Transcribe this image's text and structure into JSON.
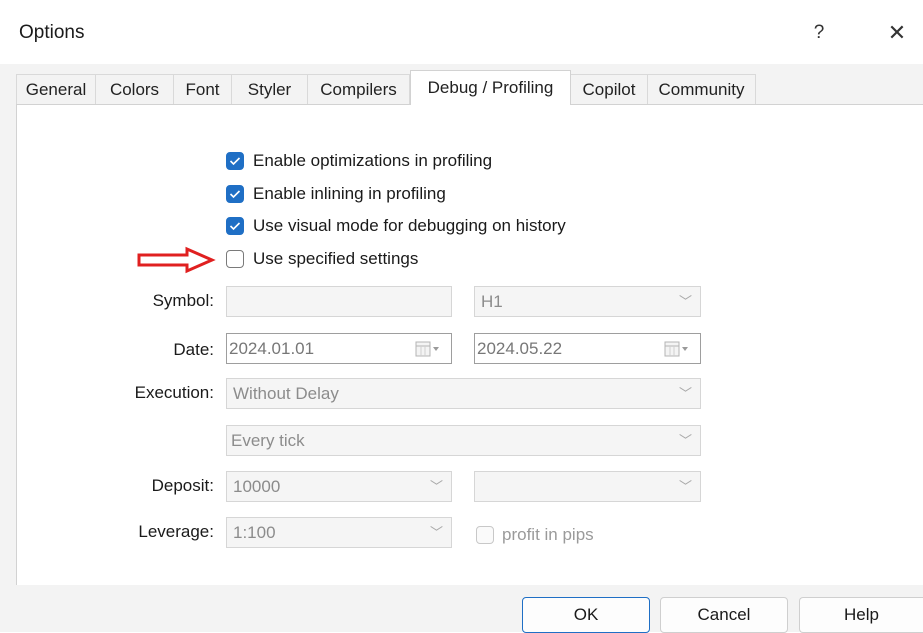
{
  "window": {
    "title": "Options",
    "help_label": "?",
    "close_label": "✕"
  },
  "tabs": [
    {
      "label": "General"
    },
    {
      "label": "Colors"
    },
    {
      "label": "Font"
    },
    {
      "label": "Styler"
    },
    {
      "label": "Compilers"
    },
    {
      "label": "Debug / Profiling",
      "active": true
    },
    {
      "label": "Copilot"
    },
    {
      "label": "Community"
    }
  ],
  "checkboxes": {
    "opt_profiling": {
      "label": "Enable optimizations in profiling",
      "checked": true
    },
    "inline_profiling": {
      "label": "Enable inlining in profiling",
      "checked": true
    },
    "visual_mode": {
      "label": "Use visual mode for debugging on history",
      "checked": true
    },
    "specified_settings": {
      "label": "Use specified settings",
      "checked": false
    },
    "profit_pips": {
      "label": "profit in pips",
      "checked": false
    }
  },
  "form": {
    "symbol_label": "Symbol:",
    "symbol_value": "",
    "timeframe_value": "H1",
    "date_label": "Date:",
    "date_from": "2024.01.01",
    "date_to": "2024.05.22",
    "execution_label": "Execution:",
    "execution_value": "Without Delay",
    "model_value": "Every tick",
    "deposit_label": "Deposit:",
    "deposit_value": "10000",
    "currency_value": "",
    "leverage_label": "Leverage:",
    "leverage_value": "1:100"
  },
  "buttons": {
    "ok": "OK",
    "cancel": "Cancel",
    "help": "Help"
  },
  "colors": {
    "accent": "#1f6fc5",
    "annotation_arrow": "#e02020"
  }
}
